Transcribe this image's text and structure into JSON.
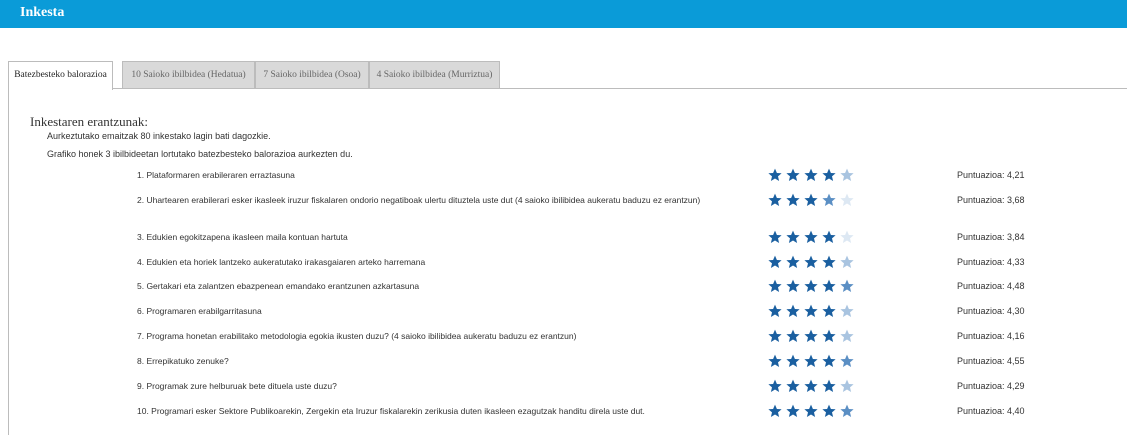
{
  "window": {
    "title": "Inkesta"
  },
  "tabs": [
    {
      "label": "Batezbesteko balorazioa",
      "active": true
    },
    {
      "label": "10 Saioko ibilbidea (Hedatua)",
      "active": false
    },
    {
      "label": "7 Saioko ibilbidea (Osoa)",
      "active": false
    },
    {
      "label": "4 Saioko ibilbidea (Murriztua)",
      "active": false
    }
  ],
  "section": {
    "heading": "Inkestaren erantzunak:",
    "description_1": "Aurkeztutako emaitzak 80 inkestako lagin bati dagozkie.",
    "description_2": "Grafiko honek 3 ibilbideetan lortutako batezbesteko balorazioa aurkezten du."
  },
  "colors": {
    "header": "#0a9bd8",
    "star_full": "#1a5fa0",
    "star_mid": "#5b8fc4",
    "star_light": "#a9c4e0",
    "star_empty": "#dde8f3"
  },
  "questions": [
    {
      "text": "1. Plataformaren erabileraren erraztasuna",
      "score_label": "Puntuazioa: 4,21",
      "rating": 4.21
    },
    {
      "text": "2. Uhartearen erabilerari esker ikasleek iruzur fiskalaren ondorio negatiboak ulertu dituztela uste dut (4 saioko ibilibidea aukeratu baduzu ez erantzun)",
      "score_label": "Puntuazioa: 3,68",
      "rating": 3.68
    },
    {
      "text": "3. Edukien egokitzapena ikasleen maila kontuan hartuta",
      "score_label": "Puntuazioa: 3,84",
      "rating": 3.84
    },
    {
      "text": "4. Edukien eta horiek lantzeko aukeratutako irakasgaiaren arteko harremana",
      "score_label": "Puntuazioa: 4,33",
      "rating": 4.33
    },
    {
      "text": "5. Gertakari eta zalantzen ebazpenean emandako erantzunen azkartasuna",
      "score_label": "Puntuazioa: 4,48",
      "rating": 4.48
    },
    {
      "text": "6. Programaren erabilgarritasuna",
      "score_label": "Puntuazioa: 4,30",
      "rating": 4.3
    },
    {
      "text": "7. Programa honetan erabilitako metodologia egokia ikusten duzu? (4 saioko ibilibidea aukeratu baduzu ez erantzun)",
      "score_label": "Puntuazioa: 4,16",
      "rating": 4.16
    },
    {
      "text": "8. Errepikatuko zenuke?",
      "score_label": "Puntuazioa: 4,55",
      "rating": 4.55
    },
    {
      "text": "9. Programak zure helburuak bete dituela uste duzu?",
      "score_label": "Puntuazioa: 4,29",
      "rating": 4.29
    },
    {
      "text": "10. Programari esker Sektore Publikoarekin, Zergekin eta Iruzur fiskalarekin zerikusia duten ikasleen ezagutzak handitu direla uste dut.",
      "score_label": "Puntuazioa: 4,40",
      "rating": 4.4
    }
  ]
}
